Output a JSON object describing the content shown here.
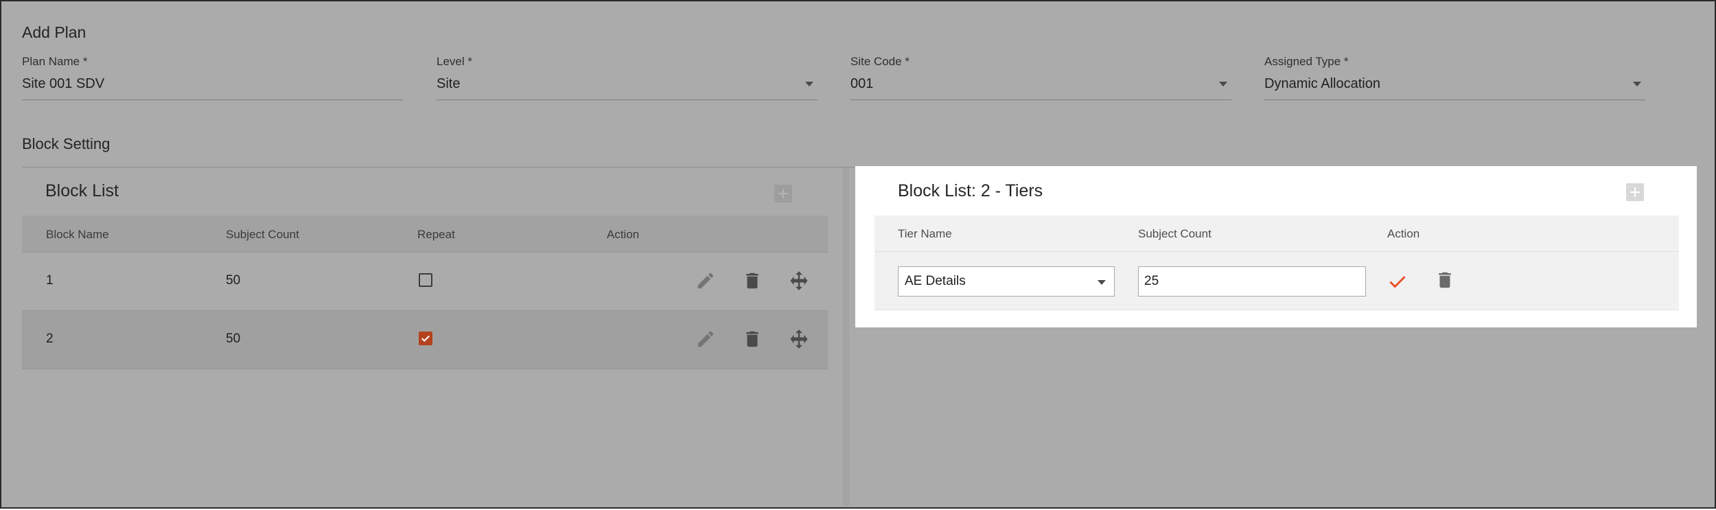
{
  "page": {
    "title": "Add Plan"
  },
  "form": {
    "plan_name": {
      "label": "Plan Name *",
      "value": "Site 001 SDV"
    },
    "level": {
      "label": "Level *",
      "value": "Site"
    },
    "site_code": {
      "label": "Site Code *",
      "value": "001"
    },
    "assigned_type": {
      "label": "Assigned Type *",
      "value": "Dynamic Allocation"
    }
  },
  "block_setting": {
    "title": "Block Setting"
  },
  "block_list": {
    "title": "Block List",
    "columns": [
      "Block Name",
      "Subject Count",
      "Repeat",
      "Action"
    ],
    "rows": [
      {
        "name": "1",
        "subject_count": "50",
        "repeat": false
      },
      {
        "name": "2",
        "subject_count": "50",
        "repeat": true
      }
    ]
  },
  "tier_list": {
    "title": "Block List: 2 - Tiers",
    "columns": [
      "Tier Name",
      "Subject Count",
      "Action"
    ],
    "row": {
      "tier_name": "AE Details",
      "subject_count": "25"
    }
  },
  "icons": {
    "edit": "pencil-icon",
    "delete": "trash-icon",
    "move": "move-arrows-icon",
    "confirm": "check-icon",
    "add": "plus-icon",
    "dropdown": "caret-down-icon"
  },
  "colors": {
    "overlay": "#ababab",
    "accent": "#e8532b",
    "checked_dimmed": "#b4421d"
  }
}
